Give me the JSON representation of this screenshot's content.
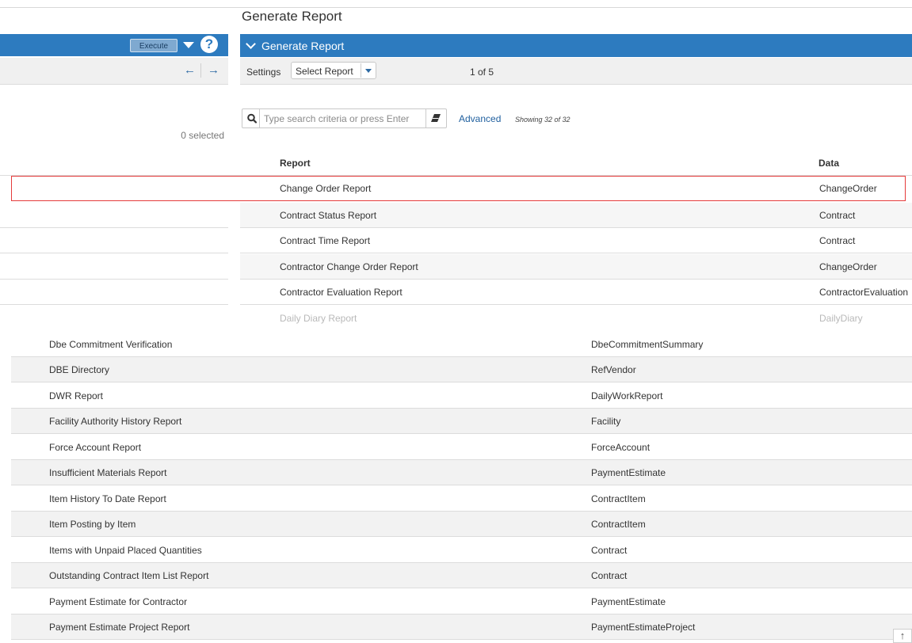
{
  "page": {
    "title": "Generate Report"
  },
  "left_panel": {
    "execute_label": "Execute",
    "nav_prev": "←",
    "nav_next": "→",
    "selected_count": "0 selected"
  },
  "panel": {
    "title": "Generate Report",
    "settings_label": "Settings",
    "select_report_label": "Select Report",
    "page_indicator": "1 of 5"
  },
  "search": {
    "placeholder": "Type search criteria or press Enter",
    "advanced_label": "Advanced",
    "showing": "Showing 32 of 32"
  },
  "table": {
    "columns": {
      "report": "Report",
      "data": "Data"
    },
    "upper_rows": [
      {
        "report": "Change Order Report",
        "data": "ChangeOrder",
        "selected": true
      },
      {
        "report": "Contract Status Report",
        "data": "Contract"
      },
      {
        "report": "Contract Time Report",
        "data": "Contract"
      },
      {
        "report": "Contractor Change Order Report",
        "data": "ChangeOrder"
      },
      {
        "report": "Contractor Evaluation Report",
        "data": "ContractorEvaluation"
      },
      {
        "report": "Daily Diary Report",
        "data": "DailyDiary",
        "faded": true
      }
    ],
    "lower_rows": [
      {
        "report": "Dbe Commitment Verification",
        "data": "DbeCommitmentSummary"
      },
      {
        "report": "DBE Directory",
        "data": "RefVendor"
      },
      {
        "report": "DWR Report",
        "data": "DailyWorkReport"
      },
      {
        "report": "Facility Authority History Report",
        "data": "Facility"
      },
      {
        "report": "Force Account Report",
        "data": "ForceAccount"
      },
      {
        "report": "Insufficient Materials Report",
        "data": "PaymentEstimate"
      },
      {
        "report": "Item History To Date Report",
        "data": "ContractItem"
      },
      {
        "report": "Item Posting by Item",
        "data": "ContractItem"
      },
      {
        "report": "Items with Unpaid Placed Quantities",
        "data": "Contract"
      },
      {
        "report": "Outstanding Contract Item List Report",
        "data": "Contract"
      },
      {
        "report": "Payment Estimate for Contractor",
        "data": "PaymentEstimate"
      },
      {
        "report": "Payment Estimate Project Report",
        "data": "PaymentEstimateProject"
      }
    ]
  },
  "icons": {
    "help": "question-circle-icon",
    "search": "search-icon",
    "eraser": "eraser-icon",
    "scroll_top": "arrow-up-icon"
  },
  "colors": {
    "header_blue": "#2d7bbf",
    "link_blue": "#1f5f9e",
    "selection_outline": "#e53b3b",
    "row_alt": "#f2f2f2"
  }
}
